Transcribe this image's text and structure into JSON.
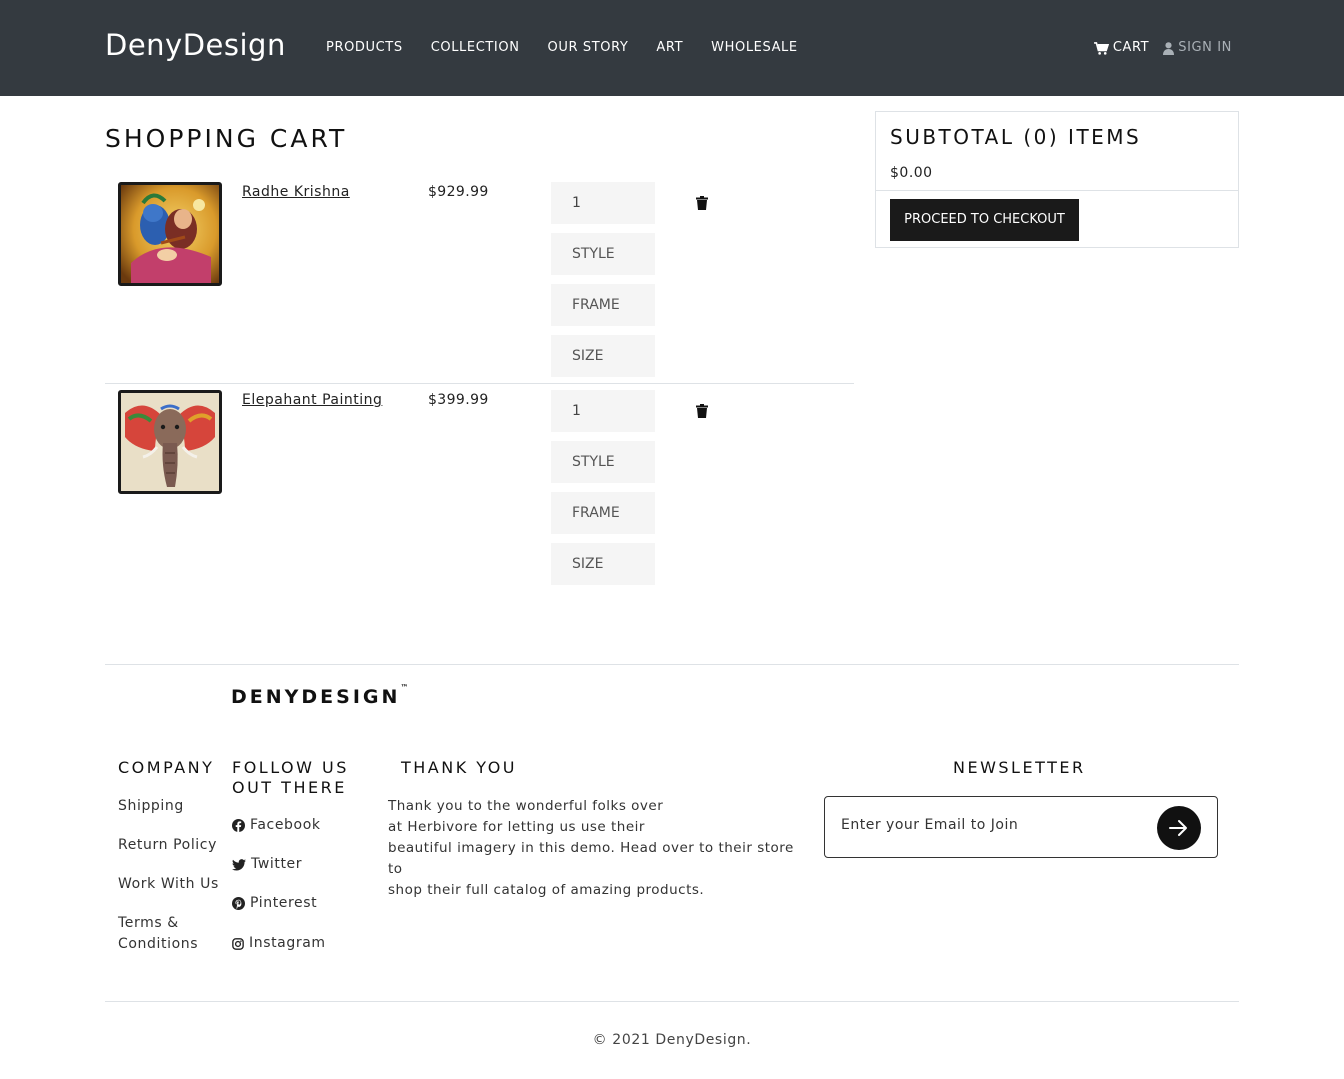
{
  "header": {
    "brand": "DenyDesign",
    "nav": [
      "PRODUCTS",
      "COLLECTION",
      "OUR STORY",
      "ART",
      "WHOLESALE"
    ],
    "cart_label": "CART",
    "signin_label": "SIGN IN"
  },
  "cart": {
    "title": "SHOPPING CART",
    "items": [
      {
        "name": "Radhe Krishna",
        "price": "$929.99",
        "quantity": "1",
        "style": "STYLE",
        "frame": "FRAME",
        "size": "SIZE",
        "thumb_icon": "radhe-krishna-painting"
      },
      {
        "name": "Elepahant Painting",
        "price": "$399.99",
        "quantity": "1",
        "style": "STYLE",
        "frame": "FRAME",
        "size": "SIZE",
        "thumb_icon": "elephant-painting"
      }
    ]
  },
  "summary": {
    "title": "SUBTOTAL (0) ITEMS",
    "amount": "$0.00",
    "checkout_label": "PROCEED TO CHECKOUT"
  },
  "footer": {
    "logo": "DENYDESIGN",
    "logo_mark": "™",
    "company": {
      "heading": "COMPANY",
      "links": [
        "Shipping",
        "Return Policy",
        "Work With Us",
        "Terms &",
        "Conditions"
      ]
    },
    "follow": {
      "heading_line1": "FOLLOW US",
      "heading_line2": "OUT THERE",
      "links": [
        "Facebook",
        "Twitter",
        "Pinterest",
        "Instagram"
      ]
    },
    "thanks": {
      "heading": "THANK YOU",
      "lines": [
        "Thank you to the wonderful folks over",
        "at Herbivore for letting us use their",
        "beautiful imagery in this demo. Head over to their store to",
        "shop their full catalog of amazing products."
      ]
    },
    "newsletter": {
      "heading": "NEWSLETTER",
      "placeholder": "Enter your Email to Join"
    },
    "copyright": "© 2021 DenyDesign."
  },
  "colors": {
    "header_bg": "#343a40",
    "button_bg": "#1a1a1a",
    "option_bg": "#f5f5f5"
  }
}
